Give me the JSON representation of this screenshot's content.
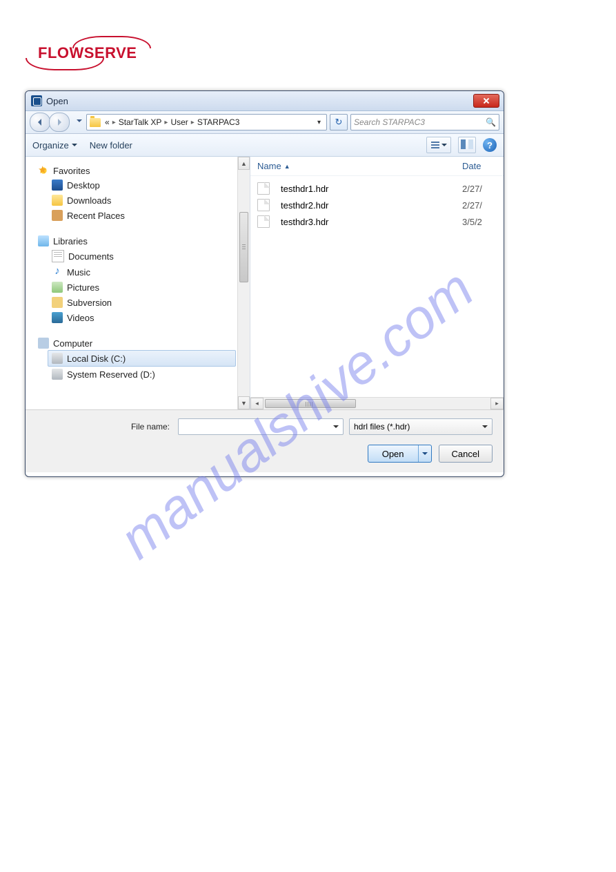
{
  "brand": {
    "name": "FLOWSERVE"
  },
  "watermark": "manualshive.com",
  "dialog": {
    "title": "Open",
    "breadcrumb": {
      "prefix": "«",
      "parts": [
        "StarTalk XP",
        "User",
        "STARPAC3"
      ]
    },
    "search_placeholder": "Search STARPAC3",
    "toolbar": {
      "organize": "Organize",
      "new_folder": "New folder"
    }
  },
  "nav": {
    "favorites": {
      "label": "Favorites",
      "items": [
        "Desktop",
        "Downloads",
        "Recent Places"
      ]
    },
    "libraries": {
      "label": "Libraries",
      "items": [
        "Documents",
        "Music",
        "Pictures",
        "Subversion",
        "Videos"
      ]
    },
    "computer": {
      "label": "Computer",
      "items": [
        "Local Disk (C:)",
        "System Reserved (D:)"
      ]
    }
  },
  "files": {
    "columns": [
      "Name",
      "Date"
    ],
    "rows": [
      {
        "name": "testhdr1.hdr",
        "date": "2/27/"
      },
      {
        "name": "testhdr2.hdr",
        "date": "2/27/"
      },
      {
        "name": "testhdr3.hdr",
        "date": "3/5/2"
      }
    ]
  },
  "footer": {
    "filename_label": "File name:",
    "filename_value": "",
    "filetype_selected": "hdrl files (*.hdr)",
    "open_label": "Open",
    "cancel_label": "Cancel"
  }
}
